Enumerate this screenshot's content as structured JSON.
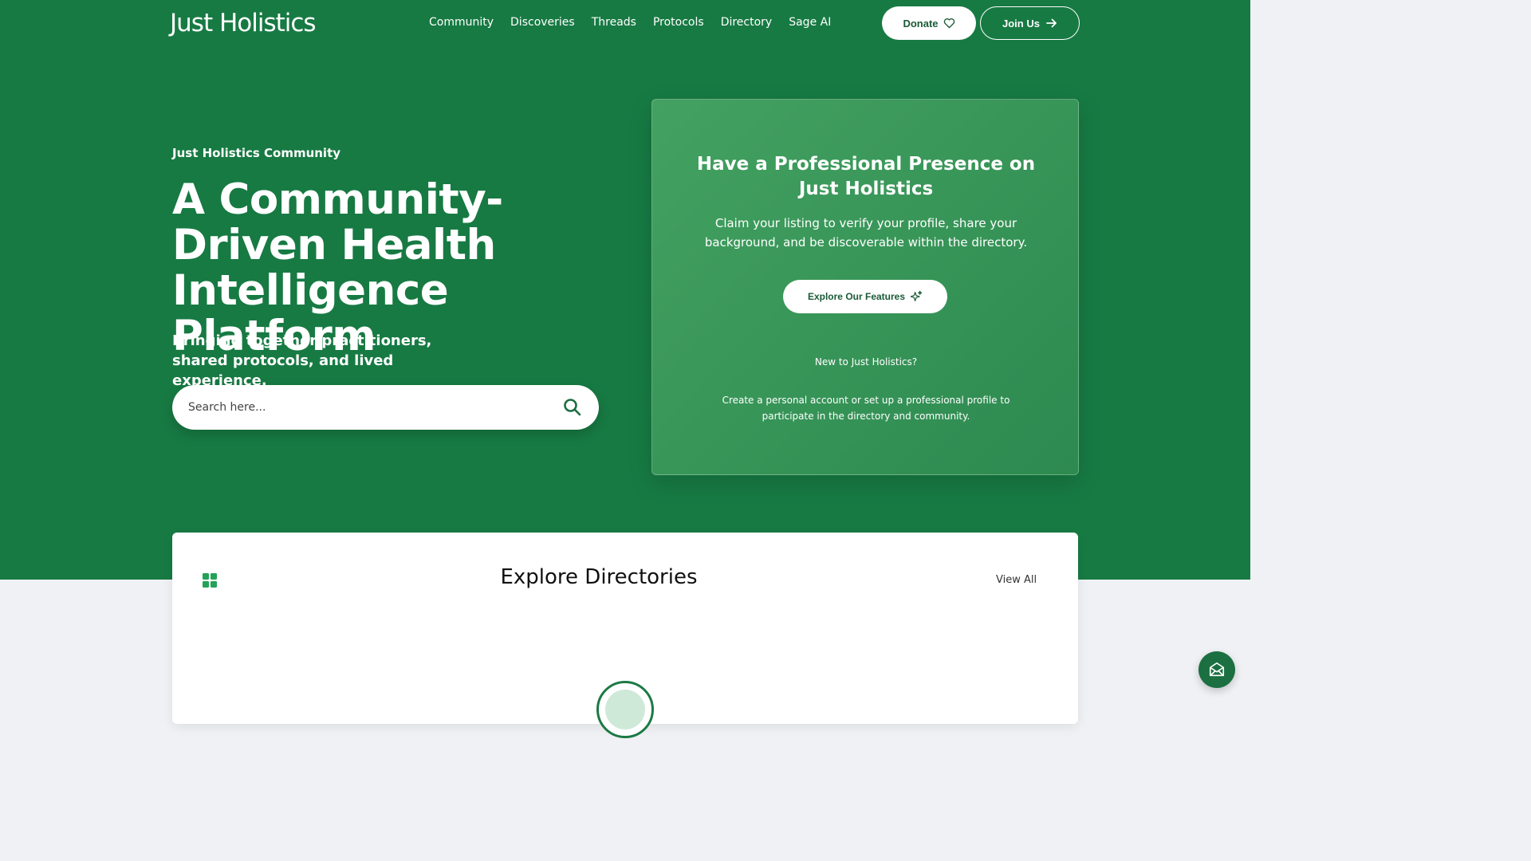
{
  "header": {
    "logo": "Just Holistics",
    "nav": [
      "Community",
      "Discoveries",
      "Threads",
      "Protocols",
      "Directory",
      "Sage AI"
    ],
    "donate_label": "Donate",
    "join_label": "Join Us"
  },
  "hero": {
    "eyebrow": "Just Holistics Community",
    "title": "A Community-Driven Health Intelligence Platform",
    "subtitle": "Bringing together practitioners, shared protocols, and lived experience.",
    "search_placeholder": "Search here..."
  },
  "card": {
    "title": "Have a Professional Presence on Just Holistics",
    "description": "Claim your listing to verify your profile, share your background, and be discoverable within the directory.",
    "button_label": "Explore Our Features",
    "new_prompt": "New to Just Holistics?",
    "create_text": "Create a personal account or set up a professional profile to participate in the directory and community."
  },
  "directories": {
    "title": "Explore Directories",
    "view_all": "View All"
  },
  "colors": {
    "brand_green": "#177a43",
    "card_green": "#3d9a5c",
    "button_text": "#1a5a36"
  },
  "icons": {
    "donate": "heart-icon",
    "join": "arrow-right-icon",
    "search": "search-icon",
    "explore": "sparkle-icon",
    "directories": "grid-icon",
    "chat": "mail-icon"
  }
}
